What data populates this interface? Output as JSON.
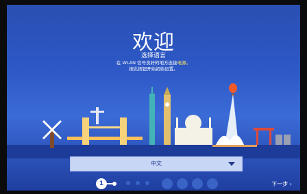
{
  "header": {
    "title": "欢迎",
    "subtitle": "选择语言",
    "hint_line1_pre": "在 WLAN 信号良好的地方连接",
    "hint_line1_highlight": "电源。",
    "hint_line2": "按此按钮开始初始设置。"
  },
  "language": {
    "selected": "中文"
  },
  "steps": {
    "current": "1"
  },
  "navigation": {
    "next_label": "下一步 ›"
  },
  "colors": {
    "background": "#2d58c6",
    "highlight": "#ffe35c",
    "dropdown_bg": "#c8d6f6"
  }
}
